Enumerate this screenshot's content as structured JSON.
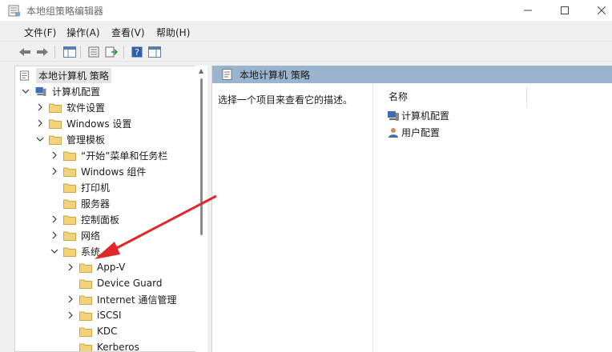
{
  "window": {
    "title": "本地组策略编辑器"
  },
  "menubar": [
    {
      "label": "文件(F)"
    },
    {
      "label": "操作(A)"
    },
    {
      "label": "查看(V)"
    },
    {
      "label": "帮助(H)"
    }
  ],
  "tree": {
    "root": "本地计算机 策略",
    "computer_config": "计算机配置",
    "items": {
      "software": "软件设置",
      "windows_settings": "Windows 设置",
      "admin_templates": "管理模板",
      "start_menu": "“开始”菜单和任务栏",
      "windows_components": "Windows 组件",
      "printers": "打印机",
      "server": "服务器",
      "control_panel": "控制面板",
      "network": "网络",
      "system": "系统",
      "appv": "App-V",
      "device_guard": "Device Guard",
      "iscsi_mgmt": "Internet 通信管理",
      "iscsi": "iSCSI",
      "kdc": "KDC",
      "kerberos": "Kerberos"
    }
  },
  "content": {
    "header": "本地计算机 策略",
    "description": "选择一个项目来查看它的描述。",
    "column_name": "名称",
    "items": [
      "计算机配置",
      "用户配置"
    ]
  },
  "colors": {
    "header_bg": "#9ab3cf",
    "annotation_arrow": "#e0282a",
    "folder": "#f3d27a"
  }
}
